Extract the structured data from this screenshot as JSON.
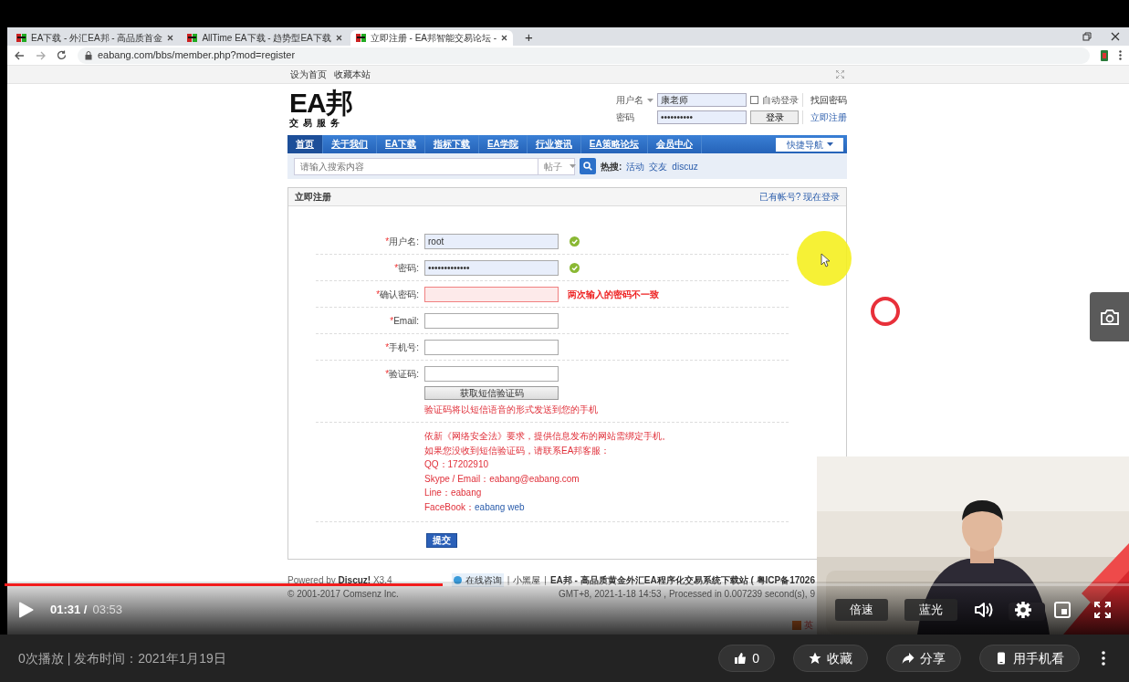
{
  "browser": {
    "tabs": [
      {
        "title": "EA下载 - 外汇EA邦 - 高品质首金",
        "selected": false
      },
      {
        "title": "AllTime EA下载 - 趋势型EA下载",
        "selected": false
      },
      {
        "title": "立即注册 - EA邦智能交易论坛 -",
        "selected": true
      }
    ],
    "new_tab": "+",
    "address": "eabang.com/bbs/member.php?mod=register"
  },
  "site": {
    "topbar_links": [
      "设为首页",
      "收藏本站"
    ],
    "logo": {
      "mark": "EA邦",
      "tagline": "交易服务"
    },
    "login": {
      "username_label": "用户名",
      "username": "康老师",
      "password_label": "密码",
      "password": "••••••••••",
      "auto_login": {
        "label": "自动登录",
        "checked": false
      },
      "login_button": "登录",
      "links": [
        "找回密码",
        "立即注册"
      ]
    },
    "nav": [
      {
        "label": "首页",
        "selected": true
      },
      {
        "label": "关于我们",
        "selected": false
      },
      {
        "label": "EA下载",
        "selected": false
      },
      {
        "label": "指标下载",
        "selected": false
      },
      {
        "label": "EA学院",
        "selected": false
      },
      {
        "label": "行业资讯",
        "selected": false
      },
      {
        "label": "EA策略论坛",
        "selected": false
      },
      {
        "label": "会员中心",
        "selected": false
      }
    ],
    "quick_nav": "快捷导航",
    "search": {
      "placeholder": "请输入搜索内容",
      "scope": "帖子",
      "hot_label": "热搜:",
      "hot": [
        "活动",
        "交友",
        "discuz"
      ]
    },
    "register": {
      "title": "立即注册",
      "login_link": "已有帐号? 现在登录",
      "fields": [
        {
          "mark": "*",
          "label": "用户名:",
          "value": "root",
          "verified": true,
          "error": false
        },
        {
          "mark": "*",
          "label": "密码:",
          "value": "•••••••••••••",
          "verified": true,
          "error": false
        },
        {
          "mark": "*",
          "label": "确认密码:",
          "verified": false,
          "error": true,
          "message": "两次输入的密码不一致"
        },
        {
          "mark": "*",
          "label": "Email:",
          "verified": false,
          "error": false
        },
        {
          "mark": "*",
          "label": "手机号:",
          "verified": false,
          "error": false
        },
        {
          "mark": "*",
          "label": "验证码:",
          "verified": false,
          "error": false
        }
      ],
      "sms_button": "获取短信验证码",
      "sms_hint": "验证码将以短信语音的形式发送到您的手机",
      "notice": [
        {
          "text": "依新《网络安全法》要求，提供信息发布的网站需绑定手机。"
        },
        {
          "text": "如果您没收到短信验证码，请联系EA邦客服："
        },
        {
          "text": "QQ：17202910"
        },
        {
          "text": "Skype / Email：eabang@eabang.com"
        },
        {
          "text": "Line：eabang"
        },
        {
          "text": "FaceBook：",
          "link": "eabang web"
        }
      ],
      "submit": "提交"
    },
    "footer": {
      "powered": "Powered by",
      "brand": "Discuz!",
      "version": "X3.4",
      "copyright": "© 2001-2017 Comsenz Inc.",
      "consult": "在线咨询",
      "sep": "|",
      "blackroom": "小黑屋",
      "site_title": "EA邦 - 高品质黄金外汇EA程序化交易系统下载站 ( 粤ICP备17026",
      "stats": "GMT+8, 2021-1-18 14:53 , Processed in 0.007239 second(s), 9",
      "ime": "英"
    }
  },
  "player": {
    "level": 0.39,
    "current": "01:31 /",
    "duration": "03:53",
    "buttons": [
      "倍速",
      "蓝光"
    ]
  },
  "info": {
    "meta": "0次播放 | 发布时间：2021年1月19日",
    "likes": "0",
    "actions": [
      "收藏",
      "分享",
      "用手机看"
    ]
  }
}
